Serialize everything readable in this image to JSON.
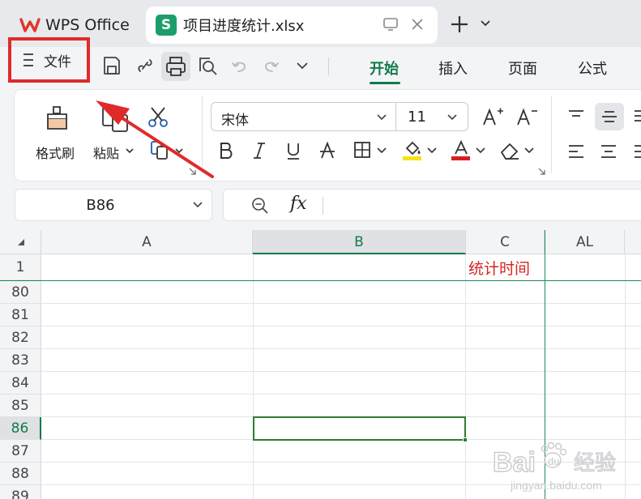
{
  "tabs": {
    "home_title": "WPS Office",
    "doc_icon_letter": "S",
    "doc_title": "项目进度统计.xlsx"
  },
  "menu": {
    "file_label": "文件",
    "ribbon_tabs": [
      "开始",
      "插入",
      "页面",
      "公式"
    ],
    "active_tab": "开始"
  },
  "ribbon": {
    "format_painter_label": "格式刷",
    "paste_label": "粘贴",
    "font_name": "宋体",
    "font_size": "11"
  },
  "formula_bar": {
    "name_box": "B86",
    "fx_label": "fx",
    "formula": ""
  },
  "grid": {
    "columns": [
      "A",
      "B",
      "C",
      "AL"
    ],
    "selected_column": "B",
    "rows": [
      "1",
      "80",
      "81",
      "82",
      "83",
      "84",
      "85",
      "86",
      "87",
      "88",
      "89"
    ],
    "selected_row": "86",
    "cell_C1": "统计时间"
  },
  "colors": {
    "accent": "#127a4b",
    "highlight_box": "#e02a2a",
    "annotation_arrow": "#e02a2a",
    "wps_brand": "#e0362c",
    "sheet_icon": "#1d9d6c"
  },
  "watermark": {
    "brand": "Bai",
    "brand_suffix": "du",
    "site_cn": "经验",
    "site_url": "jingyan.baidu.com"
  }
}
